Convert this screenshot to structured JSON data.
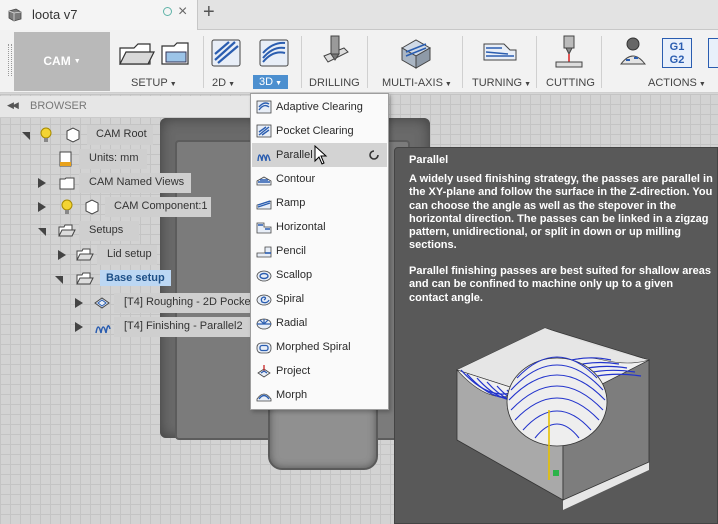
{
  "window": {
    "tab_title": "loota v7",
    "new_tab": "+",
    "close": "×"
  },
  "workspace": {
    "label": "CAM"
  },
  "ribbon": {
    "groups": [
      {
        "label": "SETUP",
        "has_dropdown": true
      },
      {
        "label": "2D",
        "has_dropdown": true
      },
      {
        "label": "3D",
        "has_dropdown": true,
        "active": true
      },
      {
        "label": "DRILLING",
        "has_dropdown": false
      },
      {
        "label": "MULTI-AXIS",
        "has_dropdown": true
      },
      {
        "label": "TURNING",
        "has_dropdown": true
      },
      {
        "label": "CUTTING",
        "has_dropdown": false
      },
      {
        "label": "ACTIONS",
        "has_dropdown": true
      }
    ],
    "gcode_icon_text": [
      "G1",
      "G2"
    ]
  },
  "browser": {
    "header": "BROWSER",
    "nodes": [
      {
        "label": "CAM Root"
      },
      {
        "label": "Units: mm"
      },
      {
        "label": "CAM Named Views"
      },
      {
        "label": "CAM Component:1"
      },
      {
        "label": "Setups"
      },
      {
        "label": "Lid setup"
      },
      {
        "label": "Base setup",
        "selected": true
      },
      {
        "label": "[T4] Roughing - 2D Pocket"
      },
      {
        "label": "[T4] Finishing - Parallel2"
      }
    ]
  },
  "menu_3d": {
    "items": [
      {
        "label": "Adaptive Clearing",
        "icon": "adaptive-clearing-icon"
      },
      {
        "label": "Pocket Clearing",
        "icon": "pocket-clearing-icon"
      },
      {
        "label": "Parallel",
        "icon": "parallel-icon",
        "hovered": true
      },
      {
        "label": "Contour",
        "icon": "contour-icon"
      },
      {
        "label": "Ramp",
        "icon": "ramp-icon"
      },
      {
        "label": "Horizontal",
        "icon": "horizontal-icon"
      },
      {
        "label": "Pencil",
        "icon": "pencil-icon"
      },
      {
        "label": "Scallop",
        "icon": "scallop-icon"
      },
      {
        "label": "Spiral",
        "icon": "spiral-icon"
      },
      {
        "label": "Radial",
        "icon": "radial-icon"
      },
      {
        "label": "Morphed Spiral",
        "icon": "morphed-spiral-icon"
      },
      {
        "label": "Project",
        "icon": "project-icon"
      },
      {
        "label": "Morph",
        "icon": "morph-icon"
      }
    ]
  },
  "tooltip": {
    "title": "Parallel",
    "paragraph1": "A widely used finishing strategy, the passes are parallel in the XY-plane and follow the surface in the Z-direction. You can choose the angle as well as the stepover in the horizontal direction. The passes can be linked in a zigzag pattern, unidirectional, or split in down or up milling sections.",
    "paragraph2": "Parallel finishing passes are best suited for shallow areas and can be confined to machine only up to a given contact angle."
  },
  "colors": {
    "accent": "#4c8fcf",
    "tooltip_bg": "#595959",
    "toolpath": "#2233cc"
  }
}
